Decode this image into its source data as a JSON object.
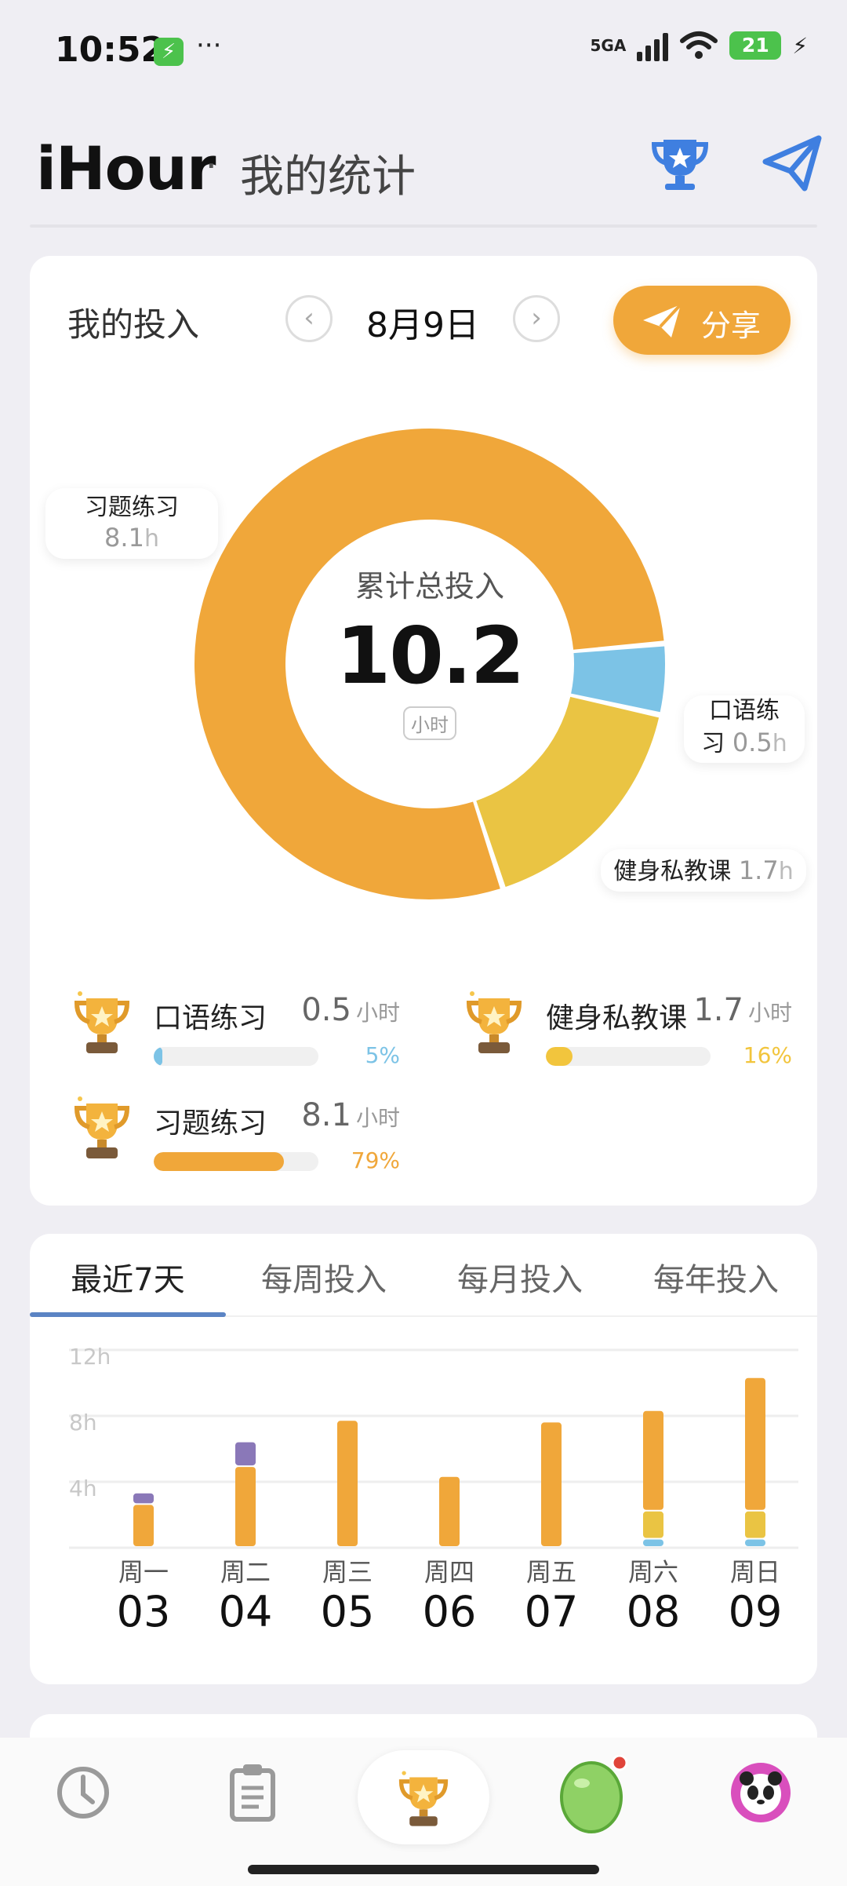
{
  "status_bar": {
    "time": "10:52",
    "dots": "···",
    "network": "5GA",
    "battery": "21",
    "bolt": "⚡"
  },
  "header": {
    "title": "iHour",
    "separator": "·",
    "subtitle": "我的统计"
  },
  "summary": {
    "section_label": "我的投入",
    "date": "8月9日",
    "prev_glyph": "‹",
    "next_glyph": "›",
    "share_label": "分享",
    "total_label": "累计总投入",
    "total_value": "10.2",
    "total_unit": "小时"
  },
  "callouts": {
    "xiti": {
      "name": "习题练习",
      "value": "8.1",
      "unit": "h"
    },
    "kouyu": {
      "name_line1": "口语练",
      "name_line2": "习",
      "value": "0.5",
      "unit": "h"
    },
    "jianshen": {
      "name": "健身私教课",
      "value": "1.7",
      "unit": "h"
    }
  },
  "legend": [
    {
      "name": "口语练习",
      "value": "0.5",
      "unit": "小时",
      "percent": "5%",
      "fraction": 0.05,
      "color": "#7cc3e6"
    },
    {
      "name": "健身私教课",
      "value": "1.7",
      "unit": "小时",
      "percent": "16%",
      "fraction": 0.16,
      "color": "#f2c53d"
    },
    {
      "name": "习题练习",
      "value": "8.1",
      "unit": "小时",
      "percent": "79%",
      "fraction": 0.79,
      "color": "#f0a73a"
    }
  ],
  "colors": {
    "accent": "#f0a73a",
    "kouyu": "#7cc3e6",
    "jianshen": "#eac443",
    "xiti": "#f0a73a",
    "purple": "#8a78b8",
    "tab_underline": "#5b84c4"
  },
  "tabs": [
    {
      "label": "最近7天",
      "active": true
    },
    {
      "label": "每周投入",
      "active": false
    },
    {
      "label": "每月投入",
      "active": false
    },
    {
      "label": "每年投入",
      "active": false
    }
  ],
  "chart_data": [
    {
      "type": "pie",
      "title": "累计总投入",
      "categories": [
        "习题练习",
        "口语练习",
        "健身私教课"
      ],
      "values": [
        8.1,
        0.5,
        1.7
      ],
      "colors": [
        "#f0a73a",
        "#7cc3e6",
        "#eac443"
      ],
      "donut": true
    },
    {
      "type": "bar",
      "stacked": true,
      "categories": [
        "03",
        "04",
        "05",
        "06",
        "07",
        "08",
        "09"
      ],
      "weekdays": [
        "周一",
        "周二",
        "周三",
        "周四",
        "周五",
        "周六",
        "周日"
      ],
      "yticks": [
        "12h",
        "8h",
        "4h"
      ],
      "ylim": [
        0,
        12
      ],
      "grid": true,
      "series": [
        {
          "color": "#7cc3e6",
          "values": [
            0,
            0,
            0,
            0,
            0,
            0.5,
            0.5
          ]
        },
        {
          "color": "#eac443",
          "values": [
            0,
            0,
            0,
            0,
            0,
            1.7,
            1.7
          ]
        },
        {
          "color": "#f0a73a",
          "values": [
            2.6,
            4.9,
            7.7,
            4.3,
            7.6,
            6.1,
            8.1
          ]
        },
        {
          "color": "#8a78b8",
          "values": [
            0.7,
            1.5,
            0,
            0,
            0,
            0,
            0
          ]
        }
      ]
    }
  ]
}
